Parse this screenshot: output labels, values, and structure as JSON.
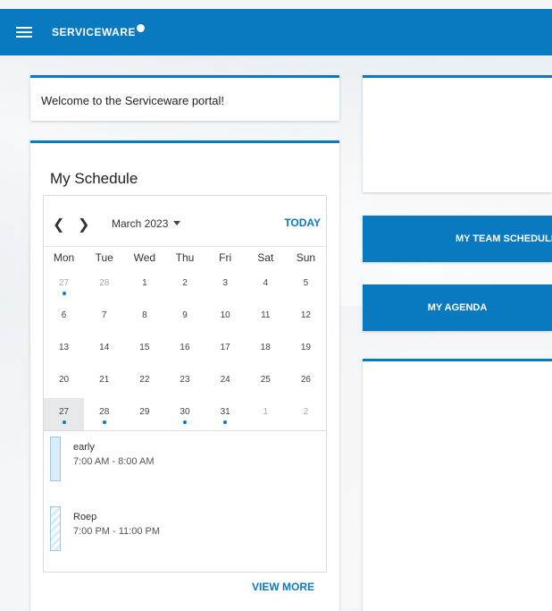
{
  "header": {
    "brand": "SERVICEWARE",
    "menu_icon": "hamburger-menu-icon",
    "accent": "#0a7ac0"
  },
  "welcome": {
    "text": "Welcome to the Serviceware portal!"
  },
  "schedule": {
    "title": "My Schedule",
    "month_label": "March 2023",
    "today_label": "TODAY",
    "weekdays": [
      "Mon",
      "Tue",
      "Wed",
      "Thu",
      "Fri",
      "Sat",
      "Sun"
    ],
    "weeks": [
      [
        {
          "d": "27",
          "out": true,
          "ev": true
        },
        {
          "d": "28",
          "out": true
        },
        {
          "d": "1"
        },
        {
          "d": "2"
        },
        {
          "d": "3"
        },
        {
          "d": "4"
        },
        {
          "d": "5"
        }
      ],
      [
        {
          "d": "6"
        },
        {
          "d": "7"
        },
        {
          "d": "8"
        },
        {
          "d": "9"
        },
        {
          "d": "10"
        },
        {
          "d": "11"
        },
        {
          "d": "12"
        }
      ],
      [
        {
          "d": "13"
        },
        {
          "d": "14"
        },
        {
          "d": "15"
        },
        {
          "d": "16"
        },
        {
          "d": "17"
        },
        {
          "d": "18"
        },
        {
          "d": "19"
        }
      ],
      [
        {
          "d": "20"
        },
        {
          "d": "21"
        },
        {
          "d": "22"
        },
        {
          "d": "23"
        },
        {
          "d": "24"
        },
        {
          "d": "25"
        },
        {
          "d": "26"
        }
      ],
      [
        {
          "d": "27",
          "sel": true,
          "ev": true
        },
        {
          "d": "28",
          "ev": true
        },
        {
          "d": "29"
        },
        {
          "d": "30",
          "ev": true
        },
        {
          "d": "31",
          "ev": true
        },
        {
          "d": "1",
          "out": true
        },
        {
          "d": "2",
          "out": true
        }
      ]
    ],
    "events": [
      {
        "name": "early",
        "time": "7:00 AM - 8:00 AM",
        "style": "solid"
      },
      {
        "name": "Roep",
        "time": "7:00 PM - 11:00 PM",
        "style": "hatch"
      }
    ],
    "view_more_label": "VIEW MORE"
  },
  "actions": {
    "team_schedule_label": "MY TEAM SCHEDULE",
    "agenda_label": "MY AGENDA"
  }
}
